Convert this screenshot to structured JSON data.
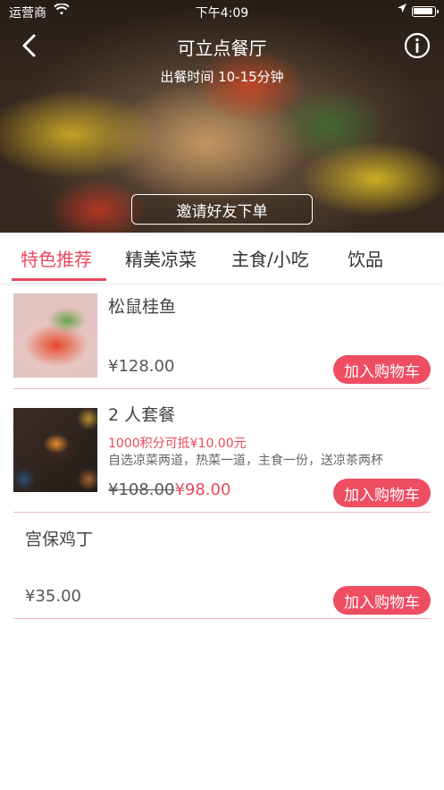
{
  "status_bar": {
    "carrier": "运营商",
    "time": "下午4:09"
  },
  "header": {
    "title": "可立点餐厅",
    "subtitle": "出餐时间 10-15分钟",
    "invite_label": "邀请好友下单"
  },
  "tabs": [
    {
      "label": "特色推荐",
      "active": true
    },
    {
      "label": "精美凉菜",
      "active": false
    },
    {
      "label": "主食/小吃",
      "active": false
    },
    {
      "label": "饮品",
      "active": false
    }
  ],
  "items": [
    {
      "name": "松鼠桂鱼",
      "price": "¥128.00",
      "cart_label": "加入购物车"
    },
    {
      "name": "2 人套餐",
      "points": "1000积分可抵¥10.00元",
      "description": "自选凉菜两道，热菜一道，主食一份，送凉茶两杯",
      "old_price": "¥108.00",
      "new_price": "¥98.00",
      "cart_label": "加入购物车"
    },
    {
      "name": "宫保鸡丁",
      "price": "¥35.00",
      "cart_label": "加入购物车"
    }
  ],
  "colors": {
    "accent": "#e84a5f",
    "cart_button": "#ee4d62",
    "divider": "#f3b8c0"
  }
}
